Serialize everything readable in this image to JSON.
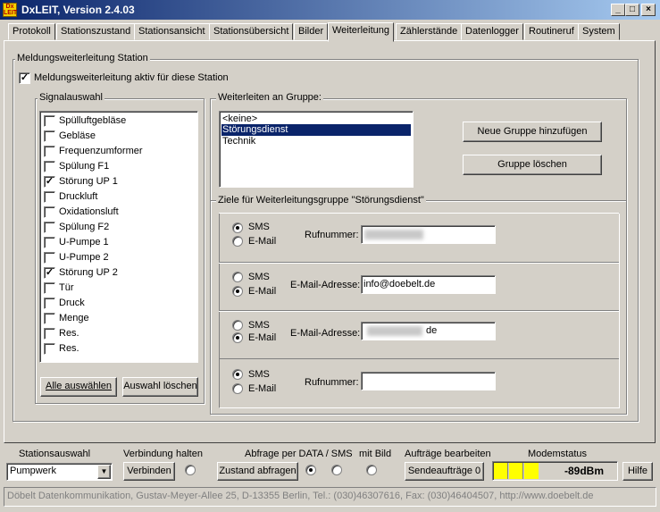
{
  "window": {
    "title": "DxLEIT, Version 2.4.03",
    "icon_text": "Dx\nLEIT",
    "minimize": "_",
    "maximize": "□",
    "close": "×"
  },
  "tabs": [
    "Protokoll",
    "Stationszustand",
    "Stationsansicht",
    "Stationsübersicht",
    "Bilder",
    "Weiterleitung",
    "Zählerstände",
    "Datenlogger",
    "Routineruf",
    "System"
  ],
  "active_tab": "Weiterleitung",
  "forwarding": {
    "group_title": "Meldungsweiterleitung Station",
    "active_label": "Meldungsweiterleitung aktiv für diese Station",
    "active_checked": true
  },
  "signals": {
    "title": "Signalauswahl",
    "items": [
      {
        "label": "Spülluftgebläse",
        "checked": false
      },
      {
        "label": "Gebläse",
        "checked": false
      },
      {
        "label": "Frequenzumformer",
        "checked": false
      },
      {
        "label": "Spülung F1",
        "checked": false
      },
      {
        "label": "Störung UP 1",
        "checked": true
      },
      {
        "label": "Druckluft",
        "checked": false
      },
      {
        "label": "Oxidationsluft",
        "checked": false
      },
      {
        "label": "Spülung F2",
        "checked": false
      },
      {
        "label": "U-Pumpe 1",
        "checked": false
      },
      {
        "label": "U-Pumpe 2",
        "checked": false
      },
      {
        "label": "Störung UP 2",
        "checked": true
      },
      {
        "label": "Tür",
        "checked": false
      },
      {
        "label": "Druck",
        "checked": false
      },
      {
        "label": "Menge",
        "checked": false
      },
      {
        "label": "Res.",
        "checked": false
      },
      {
        "label": "Res.",
        "checked": false
      }
    ],
    "select_all_label": "Alle auswählen",
    "clear_label": "Auswahl löschen"
  },
  "groups": {
    "title": "Weiterleiten an Gruppe:",
    "items": [
      "<keine>",
      "Störungsdienst",
      "Technik"
    ],
    "selected": "Störungsdienst",
    "add_label": "Neue Gruppe hinzufügen",
    "delete_label": "Gruppe löschen"
  },
  "targets": {
    "title": "Ziele für Weiterleitungsgruppe \"Störungsdienst\"",
    "sms_label": "SMS",
    "email_label": "E-Mail",
    "phone_label": "Rufnummer:",
    "email_address_label": "E-Mail-Adresse:",
    "rows": [
      {
        "mode": "sms",
        "field_label": "Rufnummer:",
        "value": ""
      },
      {
        "mode": "email",
        "field_label": "E-Mail-Adresse:",
        "value": "info@doebelt.de"
      },
      {
        "mode": "email",
        "field_label": "E-Mail-Adresse:",
        "value": "de"
      },
      {
        "mode": "sms",
        "field_label": "Rufnummer:",
        "value": ""
      }
    ]
  },
  "bottom": {
    "station_label": "Stationsauswahl",
    "station_value": "Pumpwerk",
    "connection_label": "Verbindung",
    "hold_label": "halten",
    "connect_button": "Verbinden",
    "query_label": "Abfrage per DATA / SMS",
    "with_image_label": "mit Bild",
    "query_button": "Zustand abfragen",
    "jobs_label": "Aufträge bearbeiten",
    "jobs_button": "Sendeaufträge 0",
    "modem_label": "Modemstatus",
    "modem_value": "-89dBm",
    "help_button": "Hilfe",
    "colors": {
      "modem_yellow": "#ffff00"
    }
  },
  "status_bar": "Döbelt Datenkommunikation, Gustav-Meyer-Allee 25, D-13355 Berlin, Tel.: (030)46307616, Fax: (030)46404507, http://www.doebelt.de"
}
